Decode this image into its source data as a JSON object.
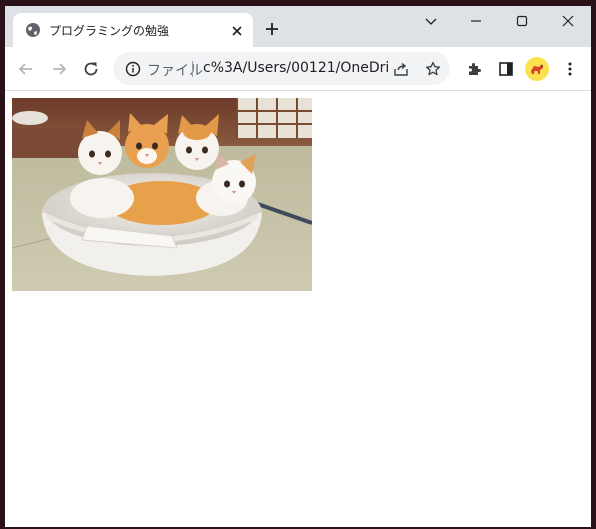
{
  "browser": {
    "tab": {
      "title": "プログラミングの勉強"
    },
    "address_bar": {
      "scheme_label": "ファイル",
      "url": "c%3A/Users/00121/OneDri..."
    }
  },
  "page": {
    "image": {
      "description_icon": "kittens-in-bowl-photo"
    }
  },
  "colors": {
    "titlebar": "#dee1e6",
    "tab": "#ffffff",
    "omnibox": "#f1f3f4",
    "avatar": "#fbe34f",
    "icon": "#5f6368"
  }
}
